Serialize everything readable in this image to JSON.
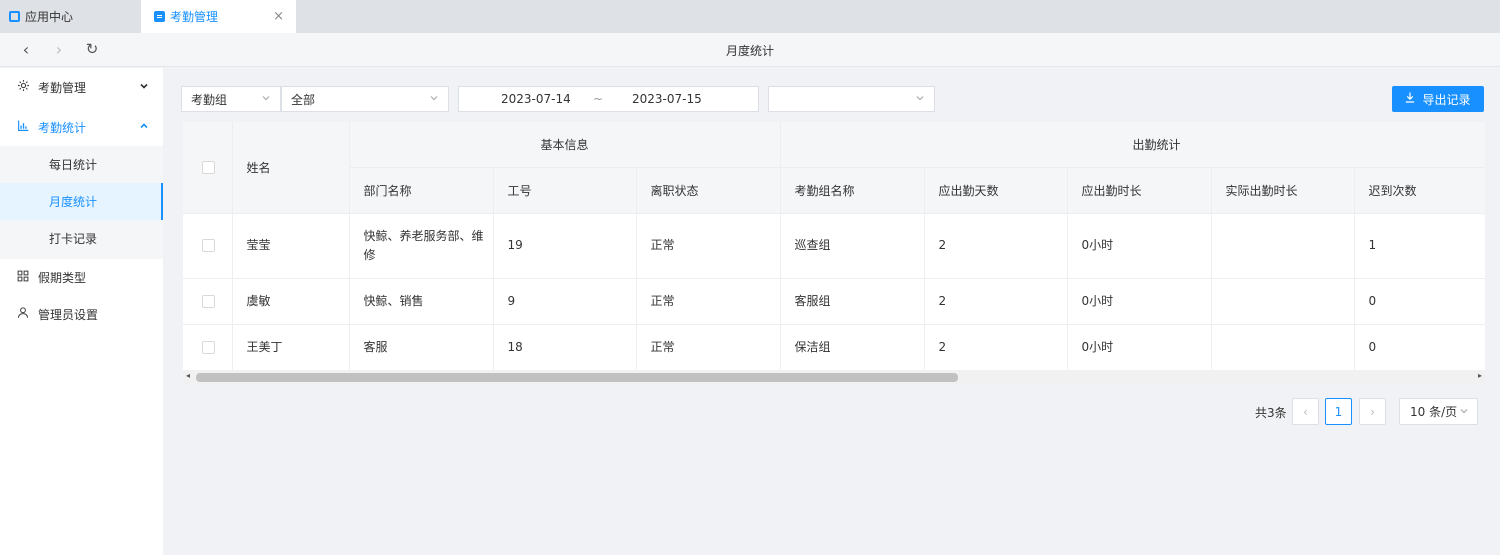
{
  "tabs": [
    {
      "label": "应用中心",
      "active": false
    },
    {
      "label": "考勤管理",
      "active": true
    }
  ],
  "tab_close_glyph": "×",
  "nav": {
    "title": "月度统计",
    "back": "‹",
    "forward": "›",
    "reload": "↻"
  },
  "sidebar": {
    "items": [
      {
        "label": "考勤管理",
        "icon": "gear-icon",
        "expanded": false
      },
      {
        "label": "考勤统计",
        "icon": "bar-chart-icon",
        "expanded": true
      },
      {
        "label": "假期类型",
        "icon": "grid-icon"
      },
      {
        "label": "管理员设置",
        "icon": "user-icon"
      }
    ],
    "subitems": [
      {
        "label": "每日统计"
      },
      {
        "label": "月度统计",
        "active": true
      },
      {
        "label": "打卡记录"
      }
    ]
  },
  "filters": {
    "group_select": "考勤组",
    "scope_select": "全部",
    "date_start": "2023-07-14",
    "date_sep": "~",
    "date_end": "2023-07-15",
    "extra_select": ""
  },
  "export_label": "导出记录",
  "table": {
    "group_headers": [
      "基本信息",
      "出勤统计"
    ],
    "name_header": "姓名",
    "columns": [
      "部门名称",
      "工号",
      "离职状态",
      "考勤组名称",
      "应出勤天数",
      "应出勤时长",
      "实际出勤时长",
      "迟到次数"
    ],
    "rows": [
      [
        "莹莹",
        "快鲸、养老服务部、维修",
        "19",
        "正常",
        "巡查组",
        "2",
        "0小时",
        "",
        "1"
      ],
      [
        "虞敏",
        "快鲸、销售",
        "9",
        "正常",
        "客服组",
        "2",
        "0小时",
        "",
        "0"
      ],
      [
        "王美丁",
        "客服",
        "18",
        "正常",
        "保洁组",
        "2",
        "0小时",
        "",
        "0"
      ]
    ]
  },
  "pagination": {
    "total": "共3条",
    "current": "1",
    "prev": "‹",
    "next": "›",
    "page_size": "10 条/页"
  },
  "colors": {
    "accent": "#1890ff",
    "header_bg": "#f5f6f8",
    "page_bg": "#f0f2f5"
  }
}
